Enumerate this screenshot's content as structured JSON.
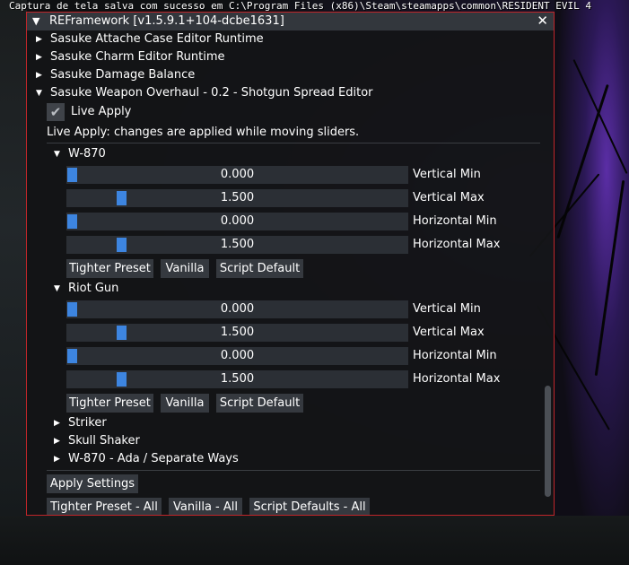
{
  "caption": "Captura de tela salva com sucesso em C:\\Program Files (x86)\\Steam\\steamapps\\common\\RESIDENT EVIL 4",
  "window": {
    "title": "REFramework [v1.5.9.1+104-dcbe1631]",
    "close_glyph": "✕",
    "collapse_glyph": "▼"
  },
  "tree": {
    "collapsed_glyph": "▶",
    "expanded_glyph": "▼",
    "attache": "Sasuke Attache Case Editor Runtime",
    "charm": "Sasuke Charm Editor Runtime",
    "damage": "Sasuke Damage Balance",
    "weapon": "Sasuke Weapon Overhaul - 0.2 - Shotgun Spread Editor"
  },
  "live_apply": {
    "label": "Live Apply",
    "checked": true,
    "check_glyph": "✔",
    "note": "Live Apply: changes are applied while moving sliders."
  },
  "sections": [
    {
      "name": "W-870",
      "sliders": [
        {
          "value": "0.000",
          "label": "Vertical Min",
          "level": 0.0
        },
        {
          "value": "1.500",
          "label": "Vertical Max",
          "level": 0.15
        },
        {
          "value": "0.000",
          "label": "Horizontal Min",
          "level": 0.0
        },
        {
          "value": "1.500",
          "label": "Horizontal Max",
          "level": 0.15
        }
      ],
      "buttons": [
        "Tighter Preset",
        "Vanilla",
        "Script Default"
      ]
    },
    {
      "name": "Riot Gun",
      "sliders": [
        {
          "value": "0.000",
          "label": "Vertical Min",
          "level": 0.0
        },
        {
          "value": "1.500",
          "label": "Vertical Max",
          "level": 0.15
        },
        {
          "value": "0.000",
          "label": "Horizontal Min",
          "level": 0.0
        },
        {
          "value": "1.500",
          "label": "Horizontal Max",
          "level": 0.15
        }
      ],
      "buttons": [
        "Tighter Preset",
        "Vanilla",
        "Script Default"
      ]
    }
  ],
  "collapsed_sections": [
    "Striker",
    "Skull Shaker",
    "W-870 - Ada / Separate Ways"
  ],
  "footer": {
    "apply": "Apply Settings",
    "tighter_all": "Tighter Preset - All",
    "vanilla_all": "Vanilla - All",
    "defaults_all": "Script Defaults - All"
  },
  "colors": {
    "border": "#c0262a",
    "slider_grab": "#3d85e0",
    "frame_bg": "#2b2f35",
    "button_bg": "#35393f",
    "title_bg": "#33373d"
  }
}
